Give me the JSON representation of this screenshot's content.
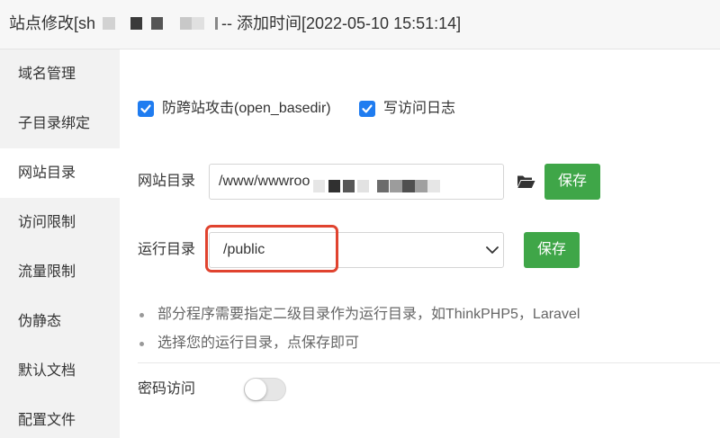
{
  "window": {
    "title_prefix": "站点修改[sh",
    "title_suffix": "-- 添加时间[2022-05-10 15:51:14]"
  },
  "sidebar": {
    "items": [
      {
        "label": "域名管理",
        "active": false
      },
      {
        "label": "子目录绑定",
        "active": false
      },
      {
        "label": "网站目录",
        "active": true
      },
      {
        "label": "访问限制",
        "active": false
      },
      {
        "label": "流量限制",
        "active": false
      },
      {
        "label": "伪静态",
        "active": false
      },
      {
        "label": "默认文档",
        "active": false
      },
      {
        "label": "配置文件",
        "active": false
      }
    ]
  },
  "options": {
    "open_basedir": {
      "label": "防跨站攻击(open_basedir)",
      "checked": true
    },
    "access_log": {
      "label": "写访问日志",
      "checked": true
    }
  },
  "site_dir": {
    "label": "网站目录",
    "value": "/www/wwwroo",
    "browse_icon": "folder-open-icon",
    "save_label": "保存"
  },
  "run_dir": {
    "label": "运行目录",
    "value": "/public",
    "dropdown_icon": "chevron-down-icon",
    "save_label": "保存"
  },
  "tips": [
    "部分程序需要指定二级目录作为运行目录，如ThinkPHP5，Laravel",
    "选择您的运行目录，点保存即可"
  ],
  "password_access": {
    "label": "密码访问",
    "enabled": false
  },
  "colors": {
    "accent": "#3fa648",
    "checkbox": "#1f7cf0",
    "highlight": "#e0432f",
    "sidebar_bg": "#f2f2f2",
    "titlebar_bg": "#f7f7f7"
  }
}
